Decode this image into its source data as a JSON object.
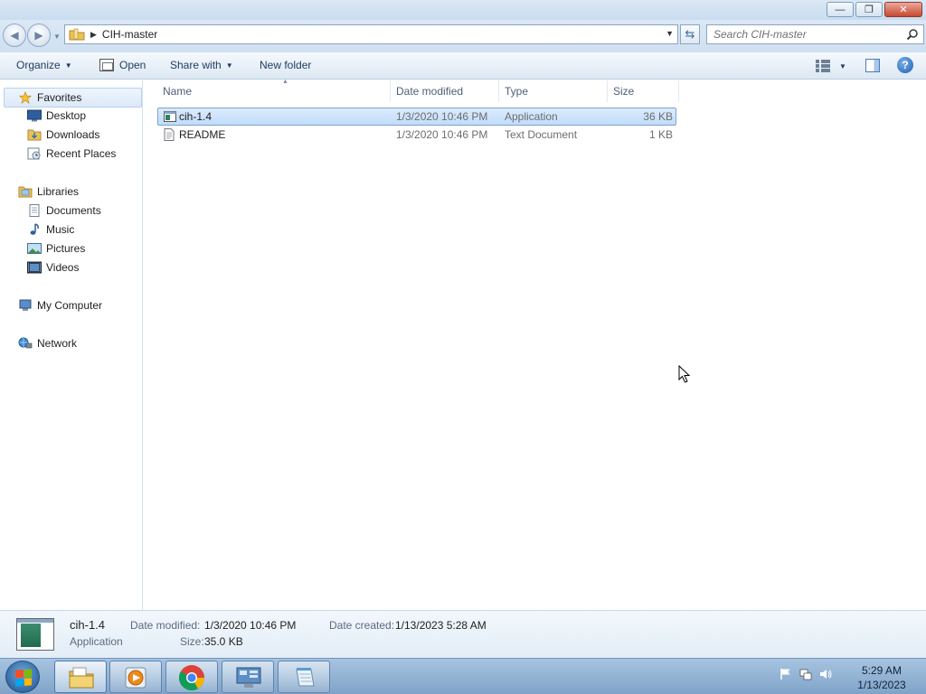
{
  "window": {
    "minimize_glyph": "—",
    "restore_glyph": "❐",
    "close_glyph": "✕"
  },
  "navbar": {
    "back_glyph": "◀",
    "forward_glyph": "▶",
    "history_glyph": "▼",
    "breadcrumb_separator": "▶",
    "address_path": "CIH-master",
    "address_dropdown_glyph": "▼",
    "refresh_glyph": "⇆",
    "search_placeholder": "Search CIH-master"
  },
  "toolbar": {
    "organize_label": "Organize",
    "open_label": "Open",
    "share_with_label": "Share with",
    "new_folder_label": "New folder",
    "caret_glyph": "▼",
    "help_glyph": "?"
  },
  "sidebar": {
    "favorites": {
      "label": "Favorites",
      "items": [
        {
          "label": "Desktop"
        },
        {
          "label": "Downloads"
        },
        {
          "label": "Recent Places"
        }
      ]
    },
    "libraries": {
      "label": "Libraries",
      "items": [
        {
          "label": "Documents"
        },
        {
          "label": "Music"
        },
        {
          "label": "Pictures"
        },
        {
          "label": "Videos"
        }
      ]
    },
    "computer": {
      "label": "My Computer"
    },
    "network": {
      "label": "Network"
    }
  },
  "file_list": {
    "columns": {
      "name": "Name",
      "date_modified": "Date modified",
      "type": "Type",
      "size": "Size"
    },
    "sort_glyph": "▲",
    "rows": [
      {
        "name": "cih-1.4",
        "date_modified": "1/3/2020 10:46 PM",
        "type": "Application",
        "size": "36 KB",
        "icon": "application-icon",
        "selected": true
      },
      {
        "name": "README",
        "date_modified": "1/3/2020 10:46 PM",
        "type": "Text Document",
        "size": "1 KB",
        "icon": "text-document-icon",
        "selected": false
      }
    ]
  },
  "details": {
    "name": "cih-1.4",
    "type": "Application",
    "date_modified_label": "Date modified:",
    "date_modified_value": "1/3/2020 10:46 PM",
    "size_label": "Size:",
    "size_value": "35.0 KB",
    "date_created_label": "Date created:",
    "date_created_value": "1/13/2023 5:28 AM"
  },
  "taskbar": {
    "buttons": [
      "file-explorer-icon",
      "media-player-icon",
      "chrome-icon",
      "control-panel-icon",
      "notepad-icon"
    ],
    "clock_time": "5:29 AM",
    "clock_date": "1/13/2023"
  },
  "colors": {
    "selection": "#c1dcfc",
    "selection_border": "#7da2ce",
    "toolbar_text": "#1e3a5f",
    "taskbar": "#8fb1d4"
  }
}
